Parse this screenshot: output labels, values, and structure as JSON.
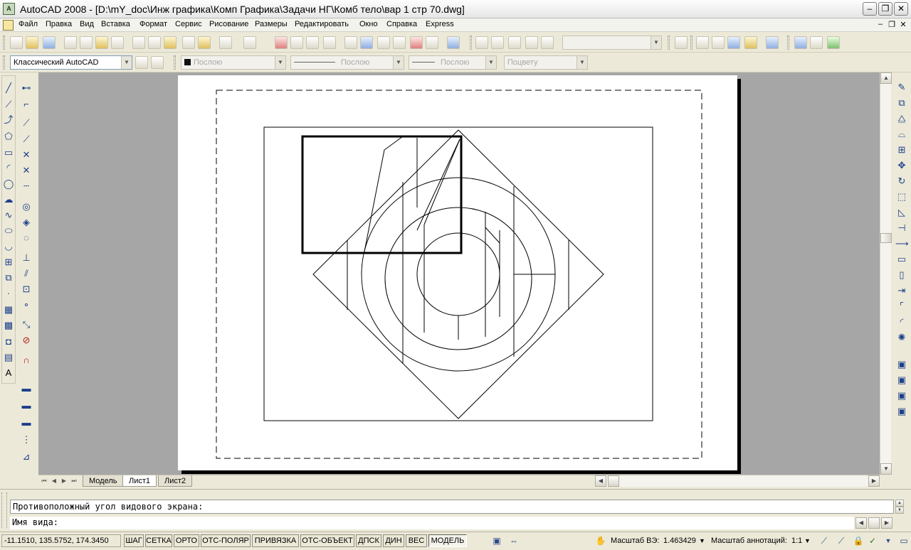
{
  "window": {
    "title": "AutoCAD 2008 - [D:\\mY_doc\\Инж графика\\Комп Графика\\Задачи НГ\\Комб тело\\вар 1 стр 70.dwg]",
    "app_icon_text": "A"
  },
  "menu": {
    "items": [
      "Файл",
      "Правка",
      "Вид",
      "Вставка",
      "Формат",
      "Сервис",
      "Рисование",
      "Размеры",
      "Редактировать",
      "Окно",
      "Справка",
      "Express"
    ]
  },
  "properties": {
    "workspace": "Классический AutoCAD",
    "color": "Послою",
    "linetype": "Послою",
    "lineweight": "Послою",
    "plotstyle": "Поцвету"
  },
  "tabs": [
    {
      "label": "Модель",
      "active": false
    },
    {
      "label": "Лист1",
      "active": true
    },
    {
      "label": "Лист2",
      "active": false
    }
  ],
  "command": {
    "history_line": "Противоположный угол видового экрана:",
    "prompt": "Имя вида:"
  },
  "status": {
    "coordinates": "-11.1510, 135.5752, 174.3450",
    "toggles": [
      {
        "label": "ШАГ",
        "pressed": false
      },
      {
        "label": "СЕТКА",
        "pressed": false
      },
      {
        "label": "ОРТО",
        "pressed": false
      },
      {
        "label": "ОТС-ПОЛЯР",
        "pressed": false
      },
      {
        "label": "ПРИВЯЗКА",
        "pressed": false
      },
      {
        "label": "ОТС-ОБЪЕКТ",
        "pressed": false
      },
      {
        "label": "ДПСК",
        "pressed": false
      },
      {
        "label": "ДИН",
        "pressed": false
      },
      {
        "label": "ВЕС",
        "pressed": false
      },
      {
        "label": "МОДЕЛЬ",
        "pressed": true
      }
    ],
    "viewport_scale_label": "Масштаб ВЭ:",
    "viewport_scale_value": "1.463429",
    "annotation_scale_label": "Масштаб аннотаций:",
    "annotation_scale_value": "1:1"
  },
  "colors": {
    "background": "#ece9d8",
    "model_space": "#a6a6a6",
    "paper": "#ffffff"
  }
}
